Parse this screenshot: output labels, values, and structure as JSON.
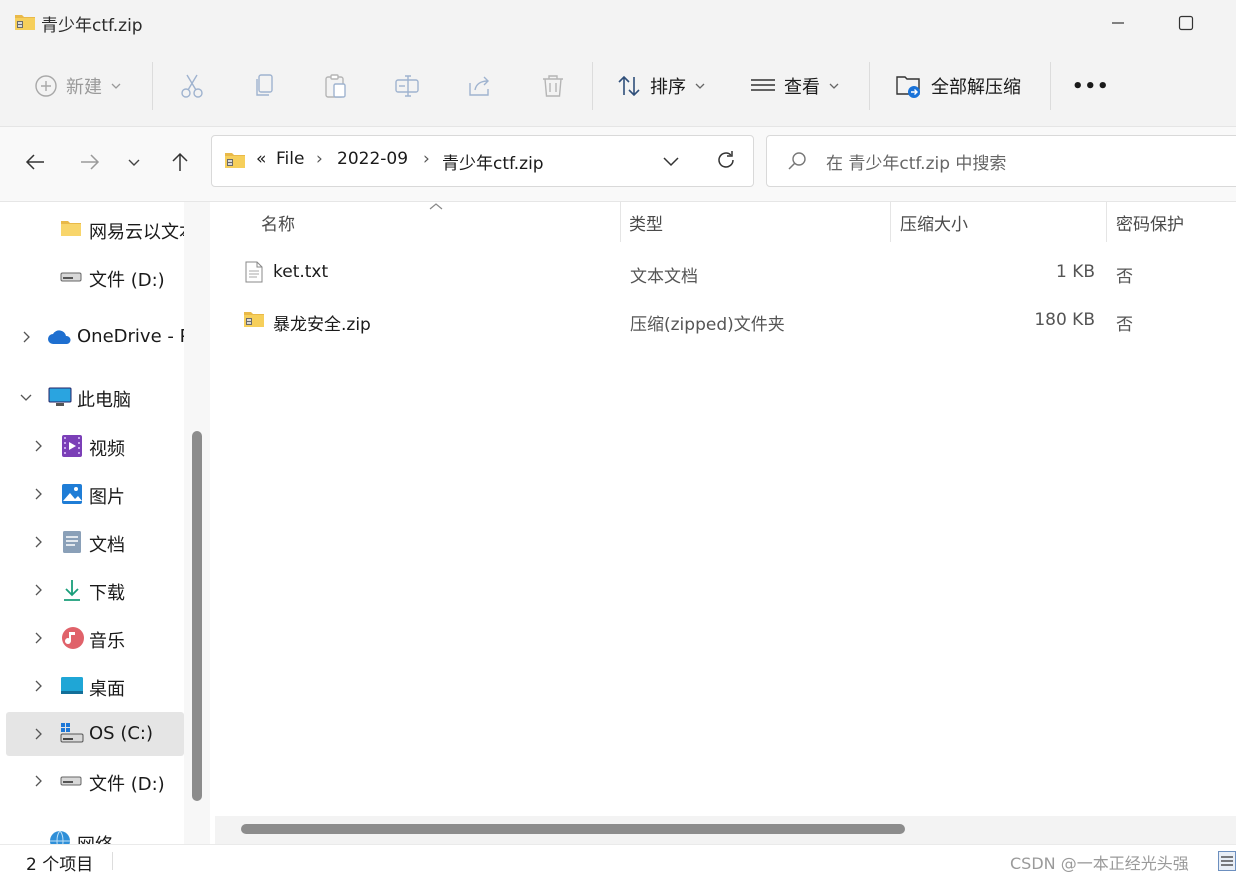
{
  "window": {
    "title": "青少年ctf.zip"
  },
  "toolbar": {
    "new_label": "新建",
    "sort_label": "排序",
    "view_label": "查看",
    "extract_label": "全部解压缩",
    "more_label": "•••"
  },
  "address": {
    "overflow": "«",
    "crumbs": [
      "File",
      "2022-09",
      "青少年ctf.zip"
    ],
    "separator": "›"
  },
  "search": {
    "placeholder": "在 青少年ctf.zip 中搜索"
  },
  "sidebar": {
    "items": [
      {
        "label": "网易云以文本",
        "icon": "folder-icon"
      },
      {
        "label": "文件 (D:)",
        "icon": "drive-icon"
      },
      {
        "label": "OneDrive - P",
        "icon": "onedrive-icon"
      },
      {
        "label": "此电脑",
        "icon": "pc-icon"
      },
      {
        "label": "视频",
        "icon": "video-icon"
      },
      {
        "label": "图片",
        "icon": "pictures-icon"
      },
      {
        "label": "文档",
        "icon": "documents-icon"
      },
      {
        "label": "下载",
        "icon": "download-icon"
      },
      {
        "label": "音乐",
        "icon": "music-icon"
      },
      {
        "label": "桌面",
        "icon": "desktop-icon"
      },
      {
        "label": "OS (C:)",
        "icon": "os-drive-icon"
      },
      {
        "label": "文件 (D:)",
        "icon": "drive-icon"
      },
      {
        "label": "网络",
        "icon": "network-icon"
      }
    ]
  },
  "columns": {
    "name": "名称",
    "type": "类型",
    "size": "压缩大小",
    "protect": "密码保护"
  },
  "files": [
    {
      "name": "ket.txt",
      "type": "文本文档",
      "size": "1 KB",
      "protect": "否",
      "icon": "text-file-icon"
    },
    {
      "name": "暴龙安全.zip",
      "type": "压缩(zipped)文件夹",
      "size": "180 KB",
      "protect": "否",
      "icon": "zip-folder-icon"
    }
  ],
  "status": {
    "count": "2 个项目"
  },
  "watermark": "CSDN @一本正经光头强"
}
